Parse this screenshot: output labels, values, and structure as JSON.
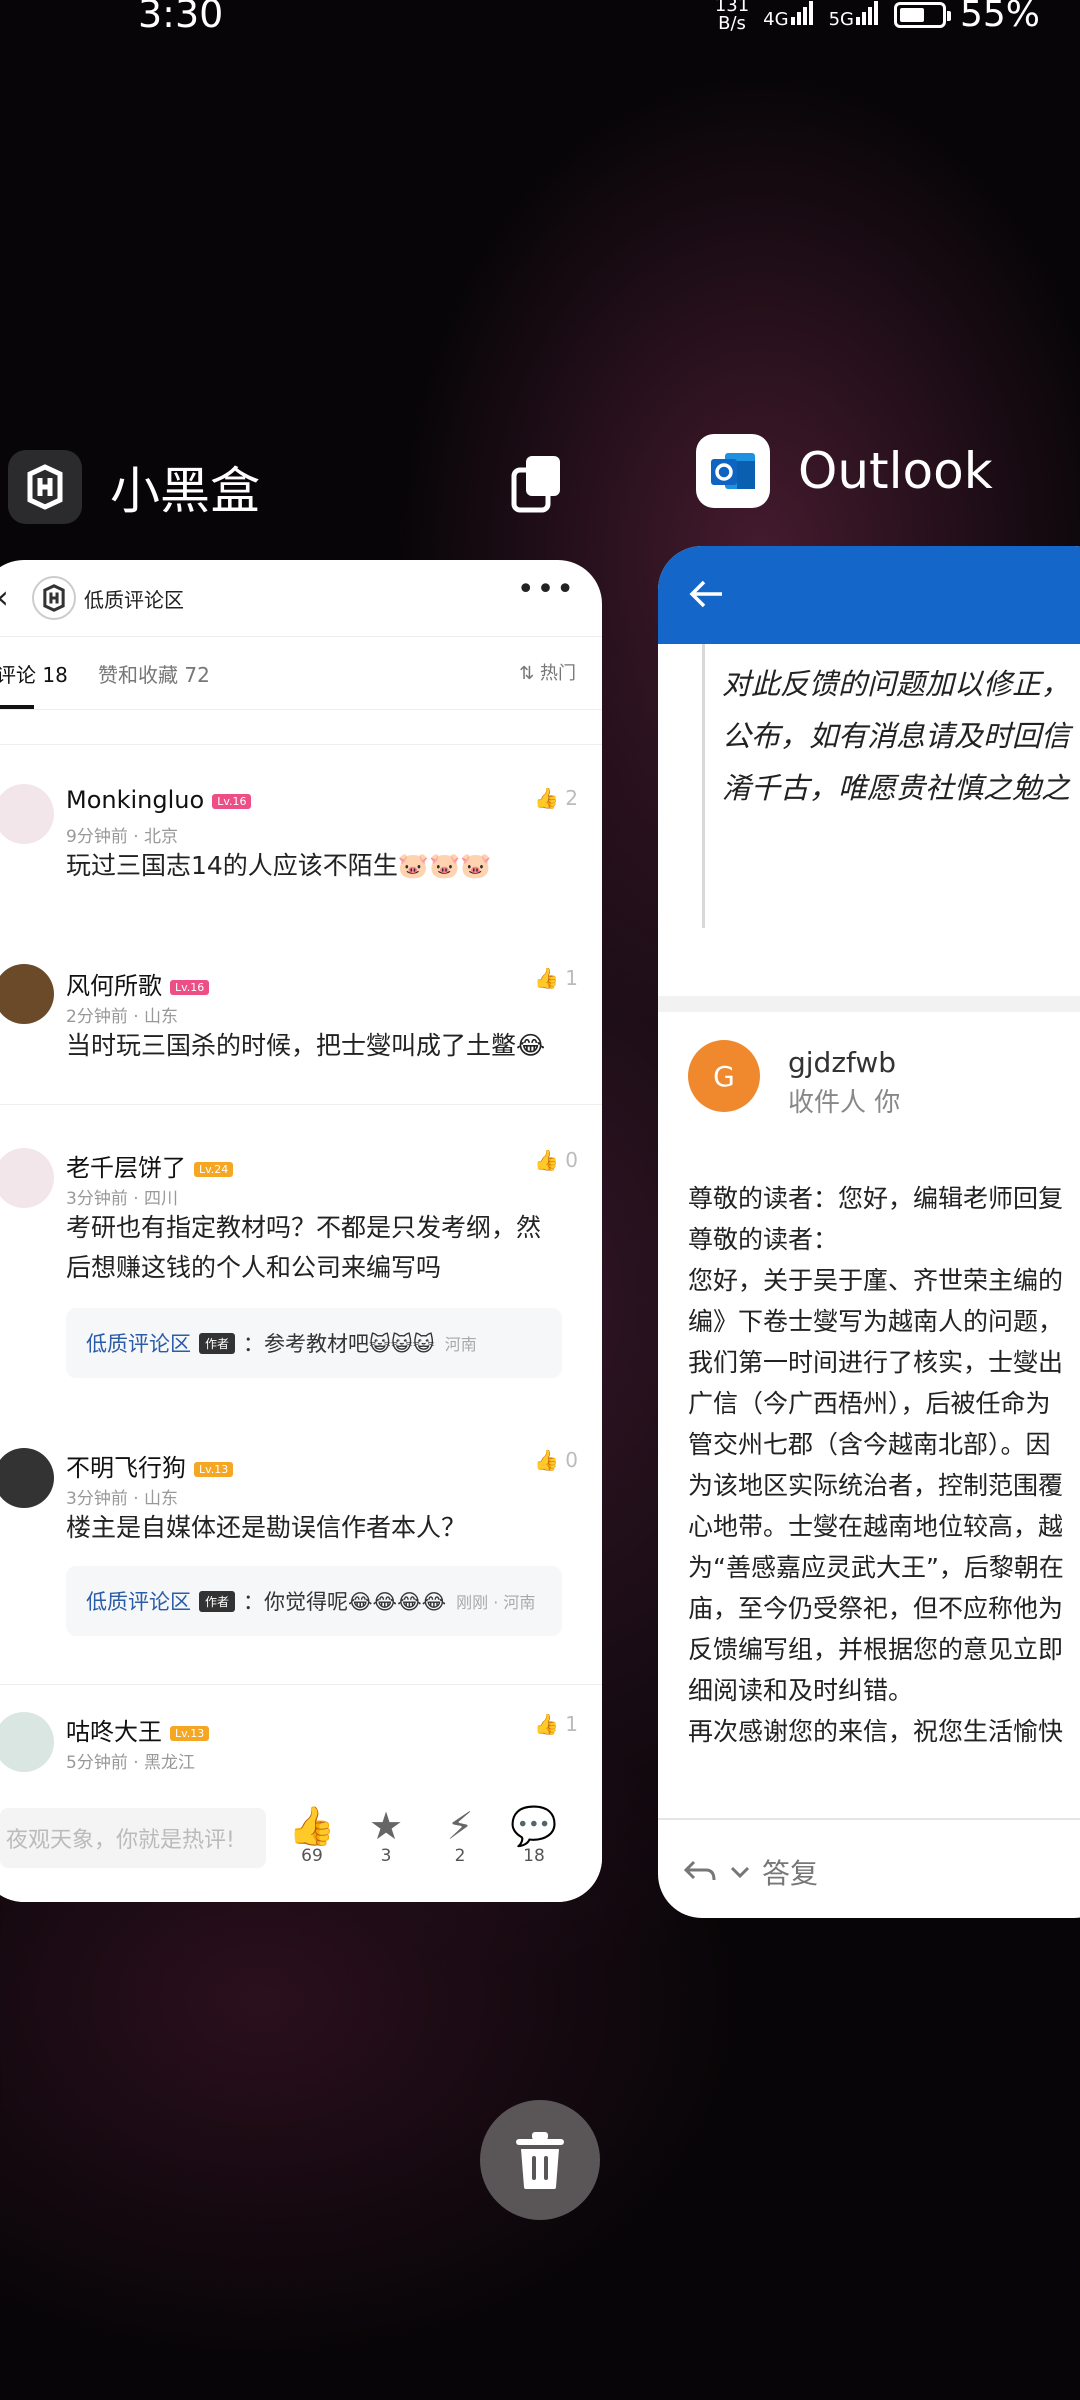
{
  "status_bar": {
    "time": "3:30",
    "net_speed": "131\nB/s",
    "net_speed_value": "131",
    "net_speed_unit": "B/s",
    "sim1": "4G",
    "sim2": "5G",
    "battery": "55%"
  },
  "apps": [
    {
      "name": "小黑盒"
    },
    {
      "name": "Outlook"
    }
  ],
  "heybox": {
    "header_title": "低质评论区",
    "tab_comments": "评论 18",
    "tab_likes": "赞和收藏 72",
    "sort_label": "热门",
    "comments": [
      {
        "user": "Monkingluo",
        "level": "Lv.16",
        "meta": "9分钟前 · 北京",
        "likes": "2",
        "text": "玩过三国志14的人应该不陌生🐷🐷🐷"
      },
      {
        "user": "风何所歌",
        "level": "Lv.16",
        "meta": "2分钟前 · 山东",
        "likes": "1",
        "text": "当时玩三国杀的时候，把士燮叫成了土鳖😂"
      },
      {
        "user": "老千层饼了",
        "level": "Lv.24",
        "meta": "3分钟前 · 四川",
        "likes": "0",
        "text_line1": "考研也有指定教材吗？不都是只发考纲，然",
        "text_line2": "后想赚这钱的个人和公司来编写吗",
        "reply": {
          "who": "低质评论区",
          "tag": "作者",
          "text": "：参考教材吧😺😺😺",
          "loc": "河南"
        }
      },
      {
        "user": "不明飞行狗",
        "level": "Lv.13",
        "meta": "3分钟前 · 山东",
        "likes": "0",
        "text": "楼主是自媒体还是勘误信作者本人？",
        "reply": {
          "who": "低质评论区",
          "tag": "作者",
          "text": "：你觉得呢😂😂😂😂",
          "loc": "刚刚 · 河南"
        }
      },
      {
        "user": "咕咚大王",
        "level": "Lv.13",
        "meta": "5分钟前 · 黑龙江",
        "likes": "1"
      }
    ],
    "input_placeholder": "夜观天象，你就是热评!",
    "actions": [
      {
        "label": "69"
      },
      {
        "label": "3"
      },
      {
        "label": "2"
      },
      {
        "label": "18"
      }
    ]
  },
  "outlook": {
    "quote_lines": [
      "对此反馈的问题加以修正，",
      "公布，如有消息请及时回信",
      "淆千古，唯愿贵社慎之勉之"
    ],
    "sender": "gjdzfwb",
    "recipient": "收件人 你",
    "avatar_letter": "G",
    "body_lines": [
      "尊敬的读者：您好，编辑老师回复",
      "尊敬的读者：",
      "您好，关于吴于廑、齐世荣主编的",
      "编》下卷士燮写为越南人的问题，",
      "我们第一时间进行了核实，士燮出",
      "广信（今广西梧州），后被任命为",
      "管交州七郡（含今越南北部）。因",
      "为该地区实际统治者，控制范围覆",
      "心地带。士燮在越南地位较高，越",
      "为“善感嘉应灵武大王”，后黎朝在",
      "庙，至今仍受祭祀，但不应称他为",
      "反馈编写组，并根据您的意见立即",
      "细阅读和及时纠错。",
      "再次感谢您的来信，祝您生活愉快"
    ],
    "reply_label": "答复"
  },
  "colors": {
    "outlook_blue": "#1467c9",
    "heybox_accent": "#2a5ca8",
    "level_pink": "#ee4e86",
    "level_orange": "#f5a623"
  }
}
